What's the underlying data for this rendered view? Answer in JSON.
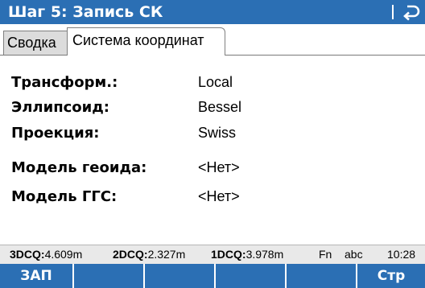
{
  "titlebar": {
    "title": "Шаг 5: Запись СК",
    "back_icon": "return-arrow-icon"
  },
  "tabs": [
    {
      "label": "Сводка",
      "active": false
    },
    {
      "label": "Система координат",
      "active": true
    }
  ],
  "fields": [
    {
      "label": "Трансформ.:",
      "value": "Local"
    },
    {
      "label": "Эллипсоид:",
      "value": "Bessel"
    },
    {
      "label": "Проекция:",
      "value": "Swiss"
    },
    {
      "label": "Модель геоида:",
      "value": "<Нет>"
    },
    {
      "label": "Модель ГГС:",
      "value": "<Нет>"
    }
  ],
  "status": {
    "dcq3_label": "3DCQ:",
    "dcq3_value": "4.609m",
    "dcq2_label": "2DCQ:",
    "dcq2_value": "2.327m",
    "dcq1_label": "1DCQ:",
    "dcq1_value": "3.978m",
    "fn": "Fn",
    "input_mode": "abc",
    "time": "10:28"
  },
  "softkeys": [
    "ЗАП",
    "",
    "",
    "",
    "",
    "Стр"
  ],
  "colors": {
    "bar_blue": "#2b6fb4",
    "status_bg": "#e9e9e9",
    "inactive_tab": "#dcdcdc"
  }
}
